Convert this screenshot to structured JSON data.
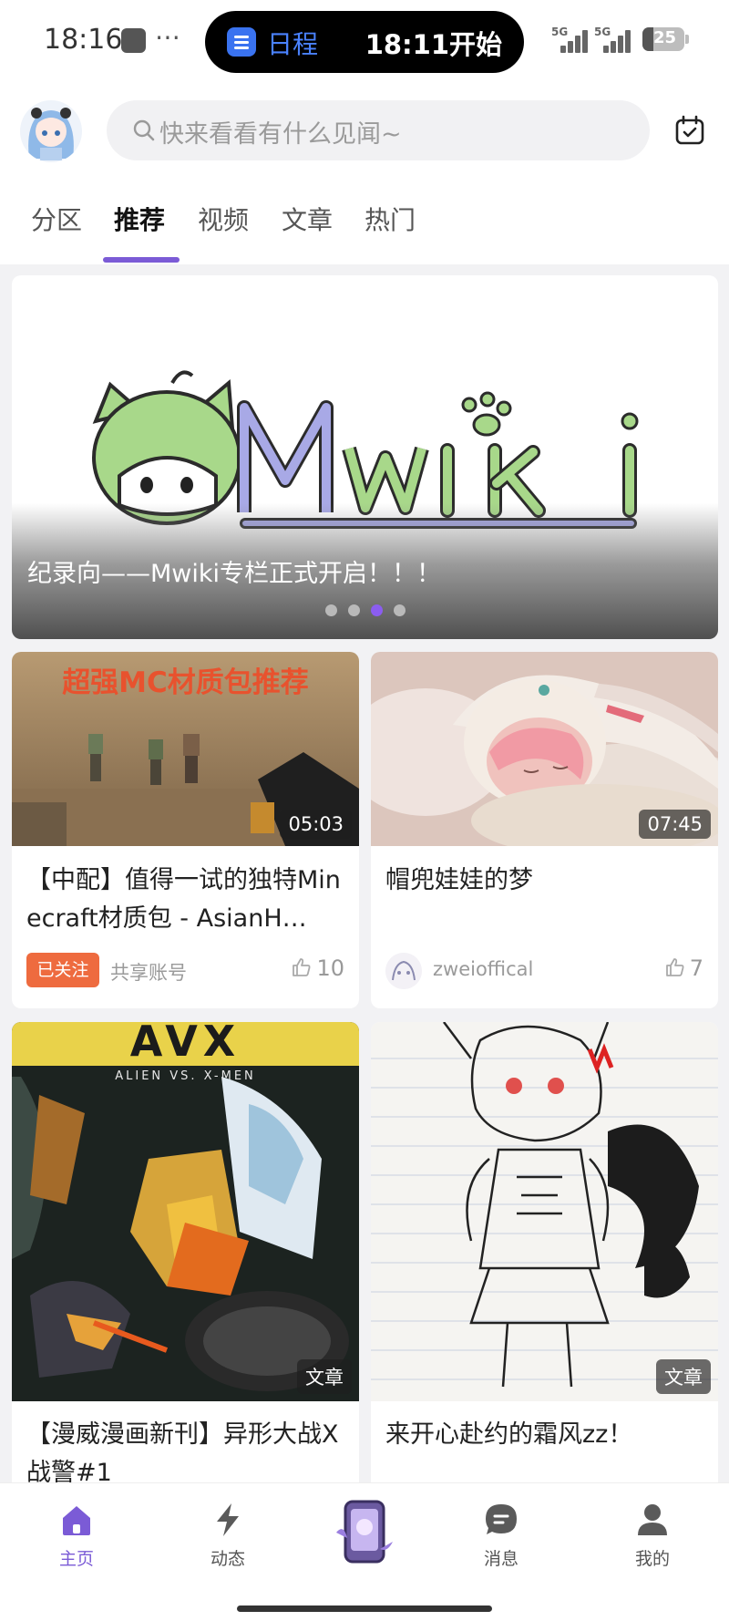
{
  "status_bar": {
    "time": "18:16",
    "more": "⋯",
    "island_label": "日程",
    "island_time": "18:11开始",
    "signal_1": "5G",
    "signal_2": "5G",
    "battery": "25"
  },
  "header": {
    "search_placeholder": "快来看看有什么见闻~"
  },
  "tabs": [
    {
      "label": "分区"
    },
    {
      "label": "推荐"
    },
    {
      "label": "视频"
    },
    {
      "label": "文章"
    },
    {
      "label": "热门"
    }
  ],
  "banner": {
    "title": "纪录向——Mwiki专栏正式开启！！！",
    "dot_count": 4,
    "active_dot": 3
  },
  "cards": [
    {
      "thumb_caption": "超强MC材质包推荐",
      "duration": "05:03",
      "title": "【中配】值得一试的独特Minecraft材质包 - AsianH…",
      "badge": "已关注",
      "author": "共享账号",
      "likes": "10"
    },
    {
      "duration": "07:45",
      "title": "帽兜娃娃的梦",
      "author": "zweioffical",
      "likes": "7"
    },
    {
      "thumb_caption": "AVX",
      "thumb_subcaption": "ALIEN VS. X-MEN",
      "type_badge": "文章",
      "title": "【漫威漫画新刊】异形大战X战警#1"
    },
    {
      "type_badge": "文章",
      "title": "来开心赴约的霜风zz！"
    }
  ],
  "bottom_nav": [
    {
      "label": "主页",
      "icon": "home-icon"
    },
    {
      "label": "动态",
      "icon": "lightning-icon"
    },
    {
      "label": "消息",
      "icon": "message-icon"
    },
    {
      "label": "我的",
      "icon": "profile-icon"
    }
  ],
  "colors": {
    "accent": "#7b5bd6",
    "followed_badge": "#ee6b3f",
    "island_blue": "#3a73f0"
  }
}
